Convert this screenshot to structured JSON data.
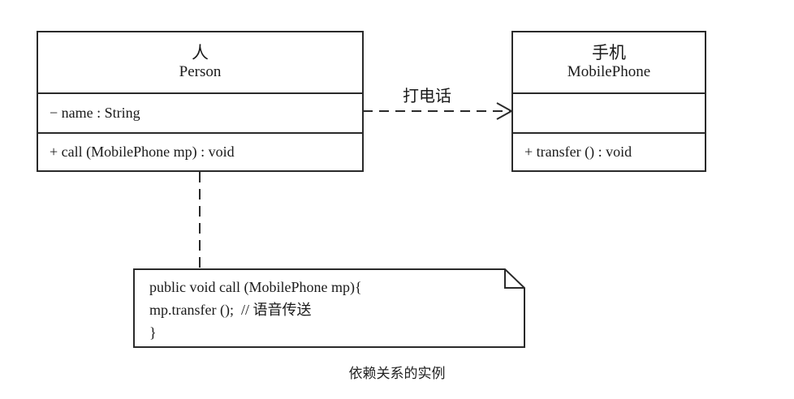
{
  "person_class": {
    "name_cn": "人",
    "name_en": "Person",
    "attribute": "− name : String",
    "method": "+ call (MobilePhone mp) : void"
  },
  "phone_class": {
    "name_cn": "手机",
    "name_en": "MobilePhone",
    "attribute": "",
    "method": "+ transfer () : void"
  },
  "dependency_label": "打电话",
  "note": {
    "lines": [
      "public void call (MobilePhone mp){",
      "mp.transfer ();  // 语音传送",
      "}"
    ]
  },
  "caption": "依赖关系的实例"
}
